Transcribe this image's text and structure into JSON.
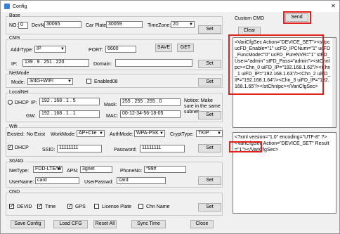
{
  "window": {
    "title": "Config",
    "close": "✕"
  },
  "base": {
    "title": "Base",
    "no_label": "NO:",
    "no_value": "0",
    "devno_label": "DevNo:",
    "devno_value": "30065",
    "carplate_label": "Car Plate:",
    "carplate_value": "30059",
    "timezone_label": "TimeZone:",
    "timezone_value": "20",
    "set": "Set"
  },
  "cms": {
    "title": "CMS",
    "addrtype_label": "AddrType:",
    "addrtype_value": "IP",
    "port_label": "PORT:",
    "port_value": "6600",
    "save": "SAVE",
    "get": "GET",
    "ip_label": "IP:",
    "ip_value": "139 .  9  . 251 . 220",
    "domain_label": "Domain:",
    "domain_value": "",
    "set": "Set"
  },
  "netmode": {
    "title": "NetMode",
    "mode_label": "Mode:",
    "mode_value": "3/4G+WIFI",
    "enabled_label": "Enabled08",
    "set": "Set"
  },
  "localnet": {
    "title": "LocalNet",
    "dhcp_label": "DHCP",
    "ip_label": "IP:",
    "ip_value": "192 . 168 .  1  .  5",
    "mask_label": "Mask:",
    "mask_value": "255 . 255 . 255 .  0",
    "notice": "Notice: Make sure in the same subnet.",
    "gw_label": "GW:",
    "gw_value": "192 . 168 .  1  .  1",
    "mac_label": "MAC:",
    "mac_value": "00-12-34-56-18-05",
    "set": "Set"
  },
  "wifi": {
    "title": "Wifi",
    "existed_label": "Existed:",
    "existed_value": "No Exist",
    "workmode_label": "WorkMode:",
    "workmode_value": "AP+Clie",
    "authmode_label": "AuthMode:",
    "authmode_value": "WPA-PSK",
    "crypttype_label": "CryptType:",
    "crypttype_value": "TKIP",
    "dhcp_label": "DHCP",
    "ssid_label": "SSID:",
    "ssid_value": "11111111",
    "password_label": "Password:",
    "password_value": "11111111",
    "set": "Set"
  },
  "g34": {
    "title": "3G/4G",
    "nettype_label": "NetType:",
    "nettype_value": "FDD-LTE/W",
    "apn_label": "APN:",
    "apn_value": "3gnet",
    "phoneno_label": "PhoneNo:",
    "phoneno_value": "*99#",
    "username_label": "UserName:",
    "username_value": "card",
    "userpasswd_label": "UserPasswd:",
    "userpasswd_value": "card",
    "set": "Set"
  },
  "osd": {
    "title": "OSD",
    "devid": "DEVID",
    "time": "Time",
    "gps": "GPS",
    "license": "License Plate",
    "chn": "Chn Name",
    "set": "Set"
  },
  "footer": {
    "save_config": "Save Config",
    "load_cfg": "Load CFG",
    "reset_all": "Reset All",
    "sync_time": "Sync Time",
    "close": "Close"
  },
  "custom": {
    "label": "Custom CMD",
    "send": "Send",
    "clear": "Clear",
    "cmd_text": "<VariCfgSec Action=\"DEVICE_SET\"><stIpc ucFD_Enable=\"1\" ucFD_IPCNum=\"1\" ucFD_FuncMode=\"0\" ucFD_PureNVR=\"1\" stFD_User=\"admin\" stFD_Pass=\"admin\"><stChnIpc><Chn_0 uiFD_IP=\"192.168.1.62\"/><Chn_1 uiFD_IP=\"192.168.1.63\"/><Chn_2 uiFD_IP=\"192.168.1.64\"/><Chn_3 uiFD_IP=\"192.168.1.65\"/></stChnIpc></VariCfgSec>",
    "response_text": "<?xml version=\"1.0\" encoding=\"UTF-8\" ?>\n<VariCfgSec Action=\"DEVICE_SET\" Result=\"1\"></VariCfgSec>"
  },
  "colors": {
    "highlight": "#e3201b",
    "bg": "#f0f0f0"
  }
}
